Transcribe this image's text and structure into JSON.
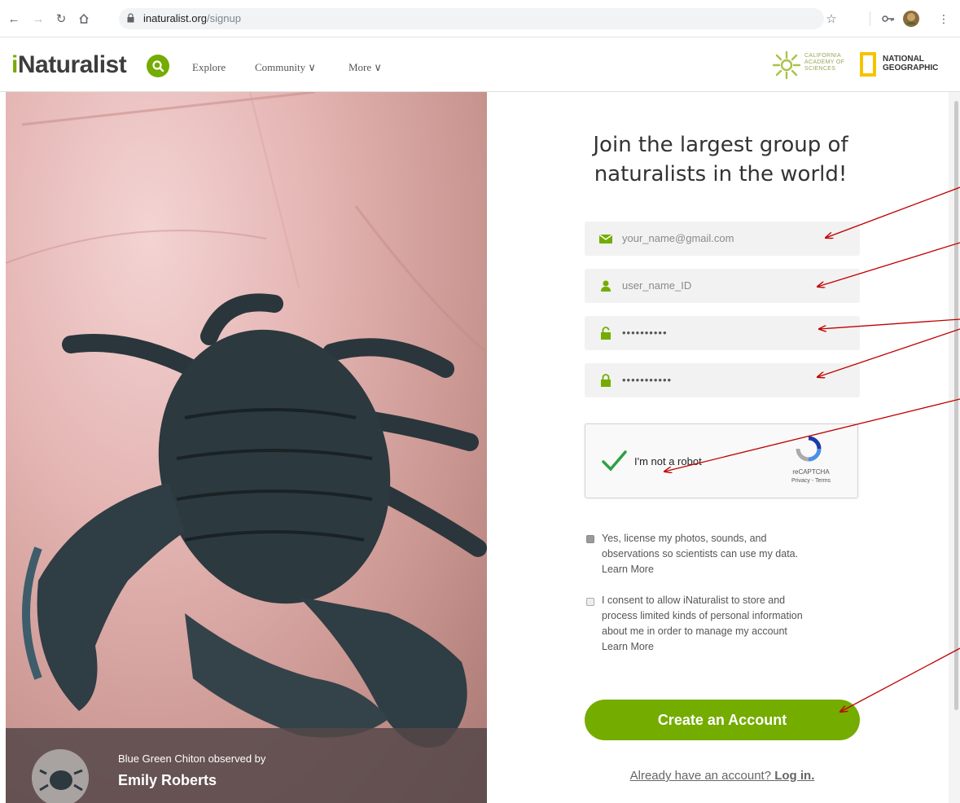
{
  "browser": {
    "url_host": "inaturalist.org",
    "url_path": "/signup"
  },
  "header": {
    "logo_i": "i",
    "logo_rest": "Naturalist",
    "nav": [
      "Explore",
      "Community ∨",
      "More ∨"
    ],
    "partner_cas": [
      "CALIFORNIA",
      "ACADEMY OF",
      "SCIENCES"
    ],
    "partner_ng": [
      "NATIONAL",
      "GEOGRAPHIC"
    ]
  },
  "photo": {
    "caption_line": "Blue Green Chiton observed by",
    "observer": "Emily Roberts"
  },
  "form": {
    "title_line1": "Join the largest group of",
    "title_line2": "naturalists in the world!",
    "email_value": "your_name@gmail.com",
    "username_value": "user_name_ID",
    "password_value": "••••••••••",
    "confirm_value": "•••••••••••",
    "captcha_label": "I'm not a robot",
    "captcha_brand": "reCAPTCHA",
    "captcha_terms": "Privacy - Terms",
    "license_checked": true,
    "license_text_1": "Yes, license my photos, sounds, and",
    "license_text_2": "observations so scientists can use my data.",
    "license_learn_more": "Learn More",
    "consent_checked": false,
    "consent_text_1": "I consent to allow iNaturalist to store and",
    "consent_text_2": "process limited kinds of personal information",
    "consent_text_3": "about me in order to manage my account",
    "consent_learn_more": "Learn More",
    "create_button": "Create an Account",
    "login_prefix": "Already have an account? ",
    "login_link": "Log in."
  },
  "colors": {
    "brand_green": "#74ac00",
    "annotation_arrow": "#c00000"
  }
}
